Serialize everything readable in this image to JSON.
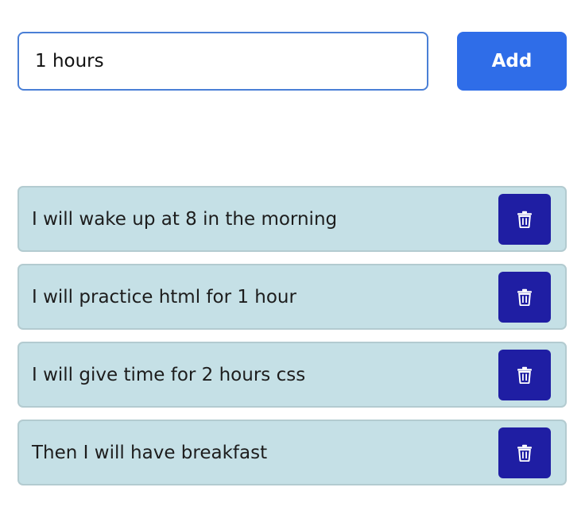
{
  "input": {
    "value": "1 hours"
  },
  "add_button": {
    "label": "Add"
  },
  "tasks": [
    {
      "text": "I will wake up at 8 in the morning",
      "delete_icon": "trash-icon"
    },
    {
      "text": "I will practice html for 1 hour",
      "delete_icon": "trash-icon"
    },
    {
      "text": "I will give time for 2 hours css",
      "delete_icon": "trash-icon"
    },
    {
      "text": "Then I will have breakfast",
      "delete_icon": "trash-icon"
    }
  ],
  "colors": {
    "add_button": "#2f6de8",
    "input_border": "#4a7fd6",
    "task_background": "#c5e0e6",
    "delete_button": "#1f1ea3"
  }
}
